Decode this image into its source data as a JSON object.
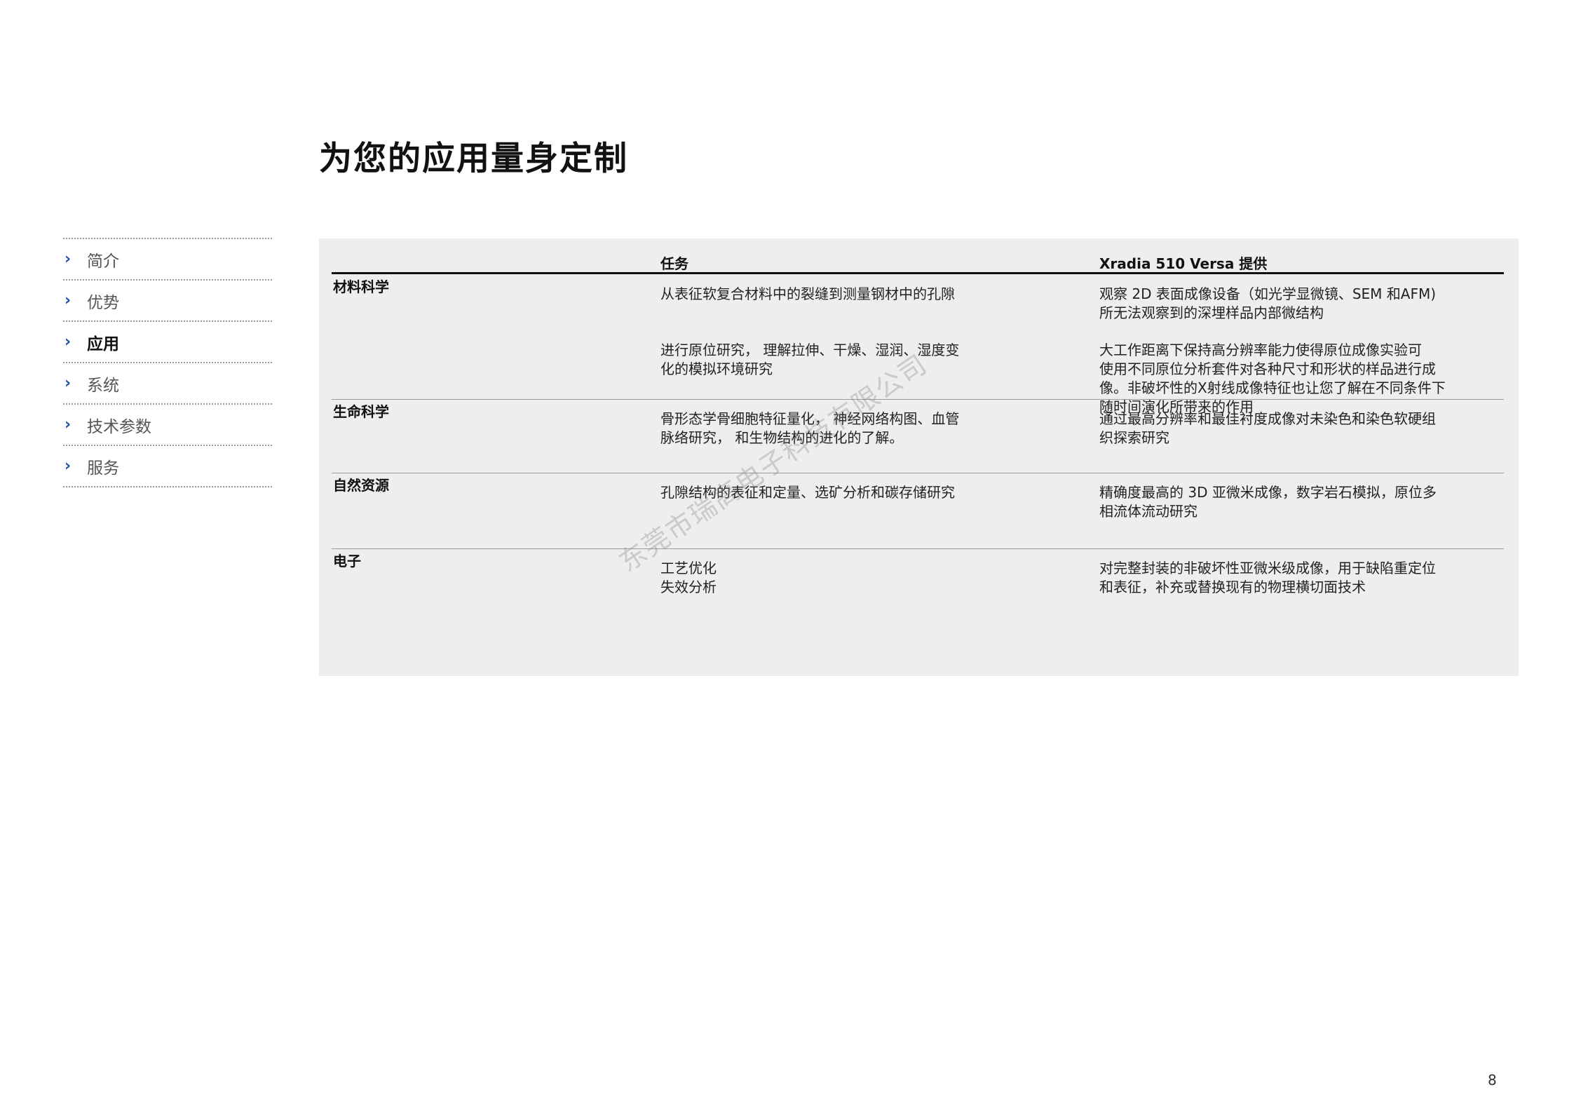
{
  "page": {
    "title": "为您的应用量身定制",
    "number": "8",
    "watermark": "东莞市瑞高电子科技有限公司"
  },
  "sidebar": {
    "items": [
      {
        "label": "简介",
        "active": false
      },
      {
        "label": "优势",
        "active": false
      },
      {
        "label": "应用",
        "active": true
      },
      {
        "label": "系统",
        "active": false
      },
      {
        "label": "技术参数",
        "active": false
      },
      {
        "label": "服务",
        "active": false
      }
    ],
    "chevron": "›"
  },
  "table": {
    "headers": {
      "category": "",
      "task": "任务",
      "offer": "Xradia 510 Versa 提供"
    },
    "rows": [
      {
        "category": "材料科学",
        "entries": [
          {
            "task": [
              "从表征软复合材料中的裂缝到测量钢材中的孔隙"
            ],
            "offer": [
              "观察 2D 表面成像设备（如光学显微镜、SEM 和AFM)",
              "所无法观察到的深埋样品内部微结构"
            ]
          },
          {
            "task": [
              "进行原位研究， 理解拉伸、干燥、湿润、湿度变",
              "化的模拟环境研究"
            ],
            "offer": [
              "大工作距离下保持高分辨率能力使得原位成像实验可",
              "使用不同原位分析套件对各种尺寸和形状的样品进行成",
              "像。非破坏性的X射线成像特征也让您了解在不同条件下",
              "随时间演化所带来的作用"
            ]
          }
        ]
      },
      {
        "category": "生命科学",
        "entries": [
          {
            "task": [
              "骨形态学骨细胞特征量化， 神经网络构图、血管",
              "脉络研究， 和生物结构的进化的了解。"
            ],
            "offer": [
              "通过最高分辨率和最佳衬度成像对未染色和染色软硬组",
              "织探索研究"
            ]
          }
        ]
      },
      {
        "category": "自然资源",
        "entries": [
          {
            "task": [
              "孔隙结构的表征和定量、选矿分析和碳存储研究"
            ],
            "offer": [
              "精确度最高的 3D 亚微米成像，数字岩石模拟，原位多",
              "相流体流动研究"
            ]
          }
        ]
      },
      {
        "category": "电子",
        "entries": [
          {
            "task": [
              "工艺优化",
              "失效分析"
            ],
            "offer": [
              "对完整封装的非破坏性亚微米级成像，用于缺陷重定位",
              "和表征，补充或替换现有的物理横切面技术"
            ]
          }
        ]
      }
    ]
  },
  "colors": {
    "accent": "#1f4e9c",
    "panel_bg": "#eeeeee",
    "rule": "#111111",
    "divider": "#9a9a9a"
  }
}
